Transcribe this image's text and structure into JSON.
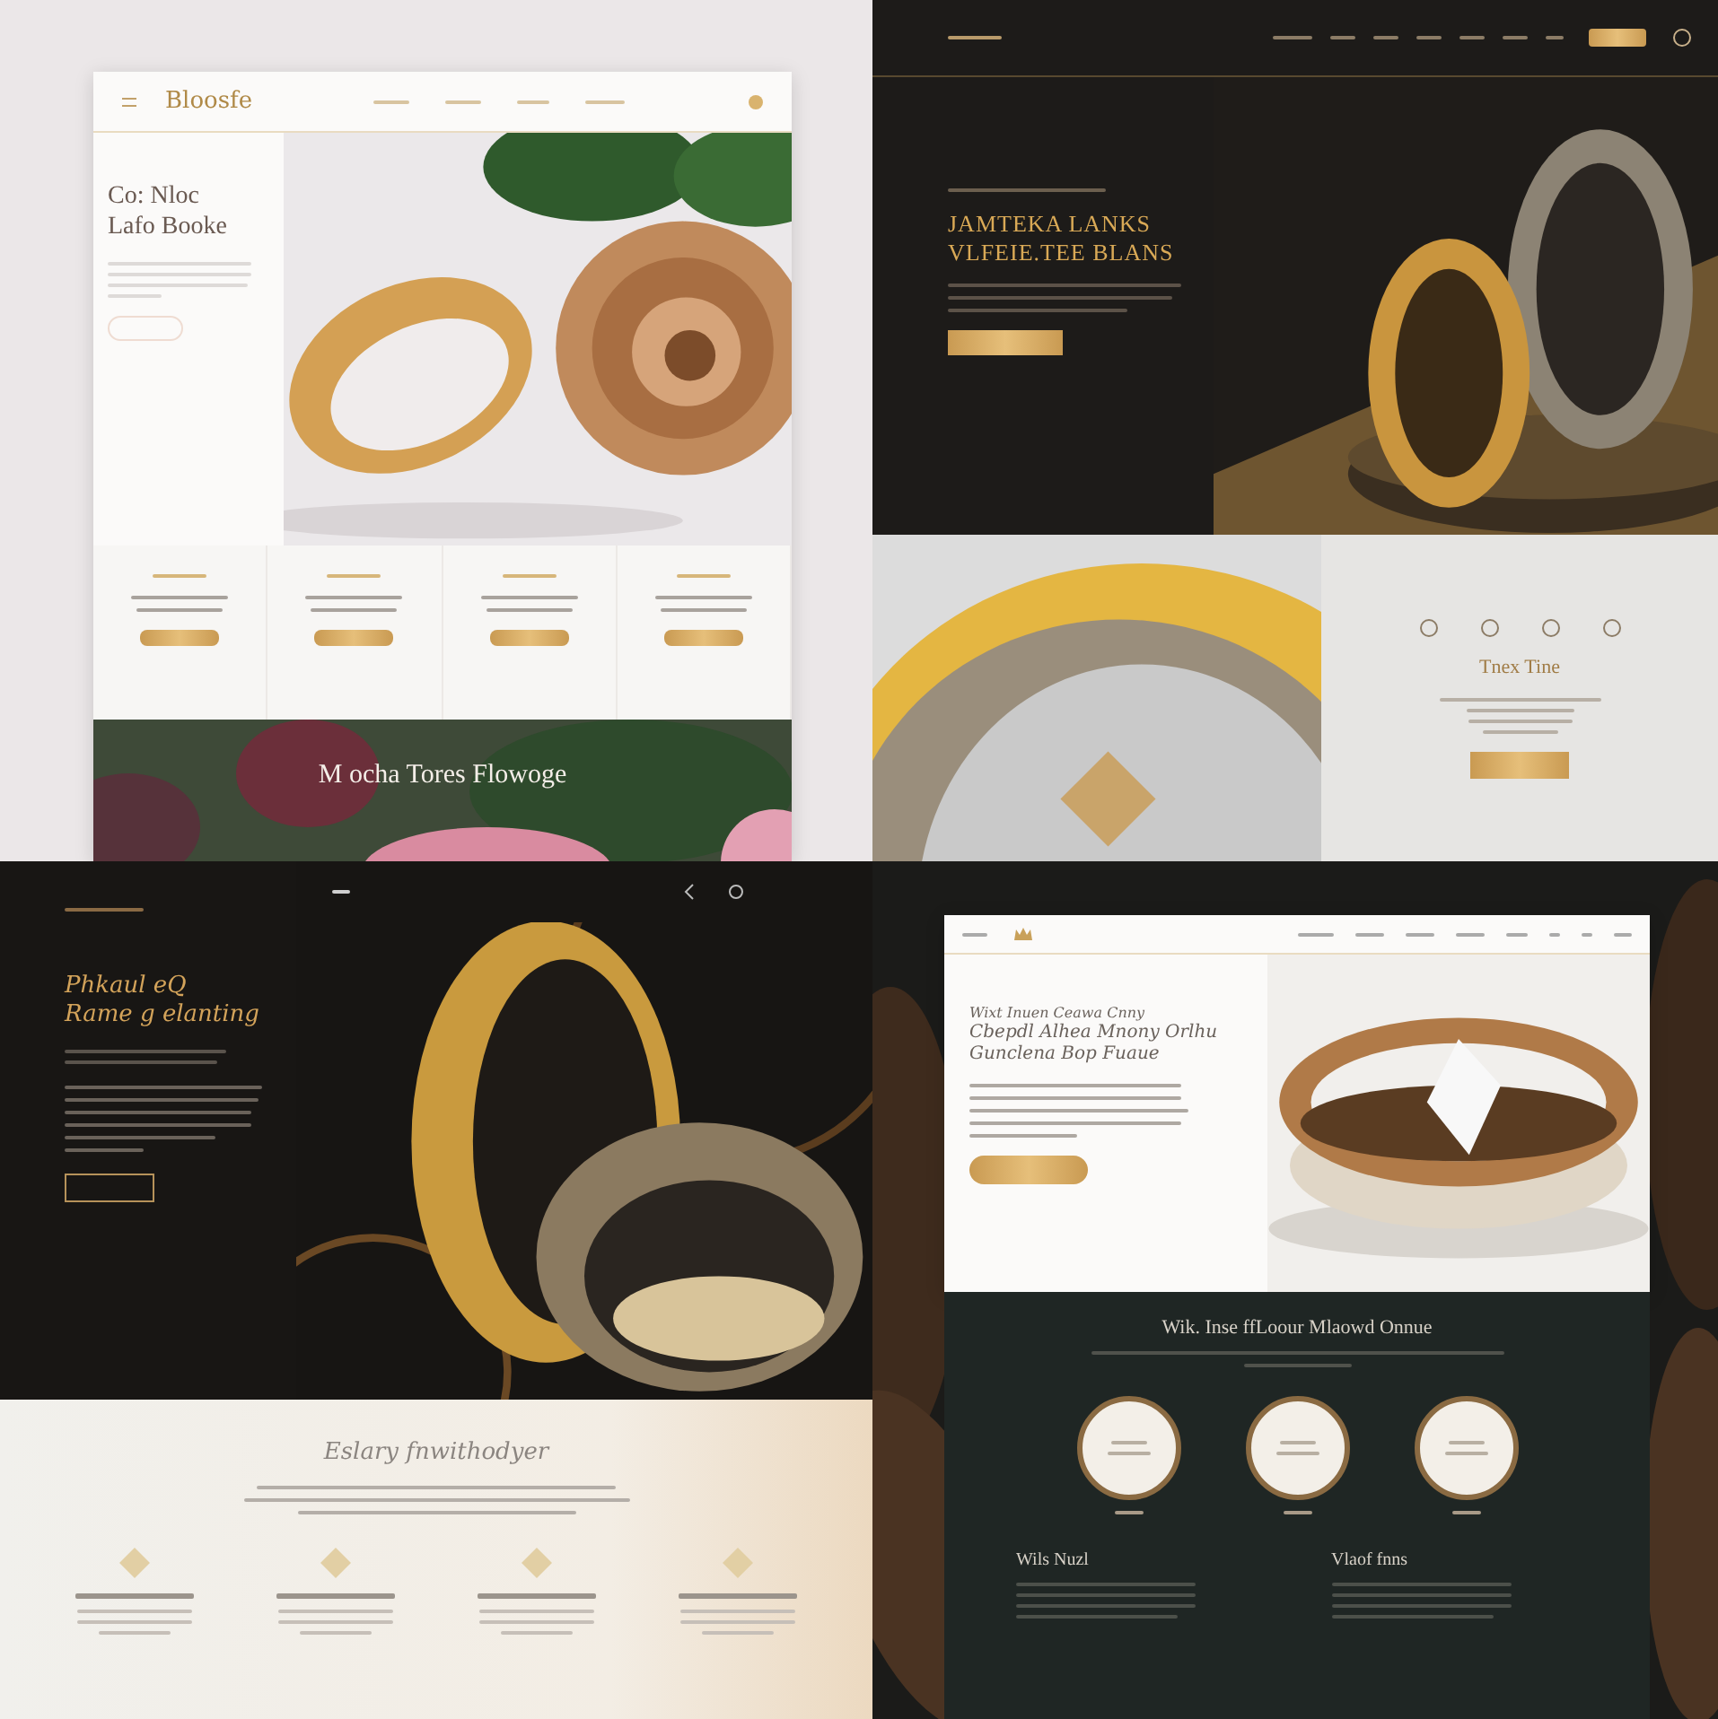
{
  "panels": [
    {
      "kind": "rose",
      "logo": "Bloosfe",
      "heading": [
        "Co: Nloc",
        "Lafo Booke"
      ],
      "banner_title": "M ocha Tores Flowoge"
    },
    {
      "kind": "geometric",
      "heading": [
        "JAMTEKA LANKS",
        "VLFEIE.TEE BLANS"
      ],
      "side_title": "Tnex Tine"
    },
    {
      "kind": "filigree",
      "heading": [
        "Phkaul eQ",
        "Rame g elanting"
      ],
      "section_title": "Eslary fnwithodyer"
    },
    {
      "kind": "diamond",
      "heading": [
        "Wixt Inuen Ceawa Cnny",
        "Cbepdl Alhea Mnony Orlhu",
        "Gunclena Bop Fuaue"
      ],
      "section_title": "Wik. Inse ffLoour Mlaowd Onnue",
      "columns": [
        "Wils Nuzl",
        "Vlaof fnns"
      ]
    }
  ]
}
